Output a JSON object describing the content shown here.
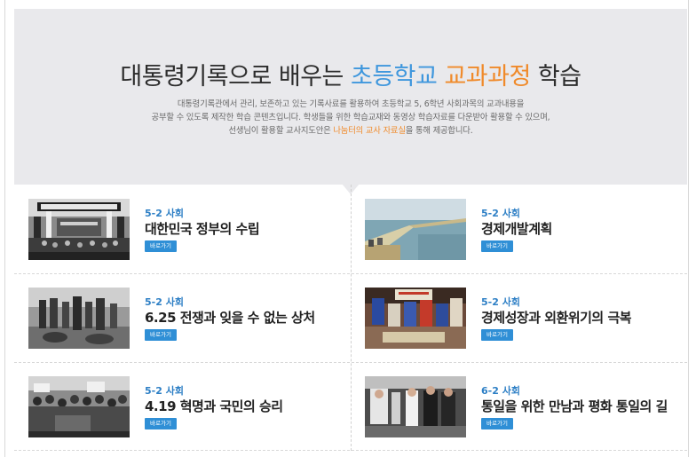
{
  "hero": {
    "title_part1": "대통령기록으로 배우는 ",
    "title_part2": "초등학교",
    "title_part3": " ",
    "title_part4": "교과과정",
    "title_part5": " 학습",
    "desc_line1": "대통령기록관에서 관리, 보존하고 있는 기록사료를 활용하여 초등학교 5, 6학년 사회과목의 교과내용을",
    "desc_line2": "공부할 수 있도록 제작한 학습 콘텐츠입니다. 학생들을 위한 학습교재와 동영상 학습자료를 다운받아 활용할 수 있으며,",
    "desc_line3_pre": "선생님이 활용할 교사지도안은 ",
    "desc_line3_link": "나눔터의 교사 자료실",
    "desc_line3_post": "을 통해 제공합니다.",
    "colors": {
      "blue": "#3f97dd",
      "orange": "#f08a2a",
      "background": "#e9e9ec"
    }
  },
  "cards": [
    {
      "subject": "5-2 사회",
      "title": "대한민국 정부의 수립",
      "button": "바로가기",
      "image": "government-ceremony-photo"
    },
    {
      "subject": "5-2 사회",
      "title": "경제개발계획",
      "button": "바로가기",
      "image": "bridge-construction-photo"
    },
    {
      "subject": "5-2 사회",
      "title": "6.25 전쟁과 잊을 수 없는 상처",
      "button": "바로가기",
      "image": "korean-war-refugees-photo"
    },
    {
      "subject": "5-2 사회",
      "title": "경제성장과 외환위기의 극복",
      "button": "바로가기",
      "image": "gold-collection-campaign-photo"
    },
    {
      "subject": "5-2 사회",
      "title": "4.19 혁명과 국민의 승리",
      "button": "바로가기",
      "image": "april-revolution-crowd-photo"
    },
    {
      "subject": "6-2 사회",
      "title": "통일을 위한 만남과 평화 통일의 길",
      "button": "바로가기",
      "image": "inter-korean-meeting-photo"
    }
  ]
}
